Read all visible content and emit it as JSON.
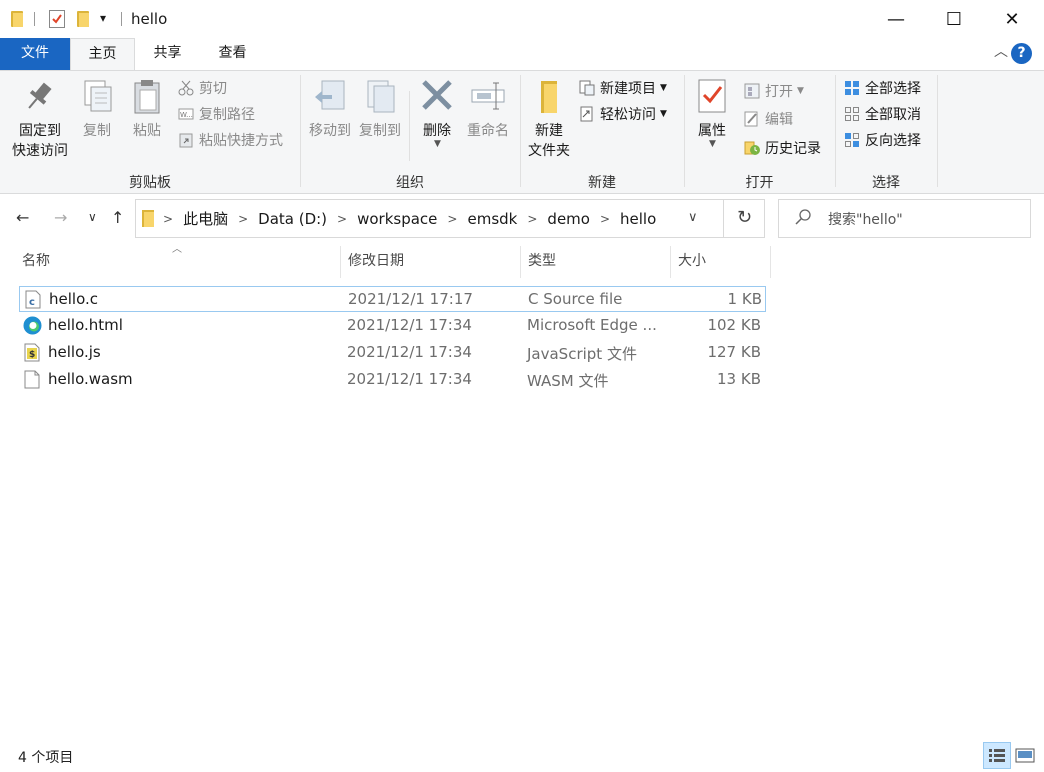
{
  "window": {
    "title": "hello",
    "controls": {
      "minimize": "—",
      "maximize": "☐",
      "close": "✕"
    }
  },
  "quick_access": {
    "dropdown": "▾"
  },
  "tabs": [
    "文件",
    "主页",
    "共享",
    "查看"
  ],
  "help": "?",
  "ribbon": {
    "clipboard": {
      "label": "剪贴板",
      "pin": "固定到\n快速访问",
      "copy": "复制",
      "paste": "粘贴",
      "cut": "剪切",
      "copy_path": "复制路径",
      "paste_shortcut": "粘贴快捷方式"
    },
    "organize": {
      "label": "组织",
      "move_to": "移动到",
      "copy_to": "复制到",
      "delete": "删除",
      "rename": "重命名"
    },
    "new": {
      "label": "新建",
      "new_folder": "新建\n文件夹",
      "new_item": "新建项目",
      "easy_access": "轻松访问"
    },
    "open": {
      "label": "打开",
      "properties": "属性",
      "open": "打开",
      "edit": "编辑",
      "history": "历史记录"
    },
    "select": {
      "label": "选择",
      "select_all": "全部选择",
      "select_none": "全部取消",
      "invert": "反向选择"
    }
  },
  "nav": {
    "back": "←",
    "forward": "→",
    "recent": "∨",
    "up": "↑",
    "refresh": "↻"
  },
  "breadcrumb": [
    "此电脑",
    "Data (D:)",
    "workspace",
    "emsdk",
    "demo",
    "hello"
  ],
  "search": {
    "placeholder": "搜索\"hello\""
  },
  "columns": [
    "名称",
    "修改日期",
    "类型",
    "大小"
  ],
  "files": [
    {
      "name": "hello.c",
      "date": "2021/12/1 17:17",
      "type": "C Source file",
      "size": "1 KB",
      "icon": "c-source-file-icon"
    },
    {
      "name": "hello.html",
      "date": "2021/12/1 17:34",
      "type": "Microsoft Edge ...",
      "size": "102 KB",
      "icon": "edge-html-icon"
    },
    {
      "name": "hello.js",
      "date": "2021/12/1 17:34",
      "type": "JavaScript 文件",
      "size": "127 KB",
      "icon": "javascript-file-icon"
    },
    {
      "name": "hello.wasm",
      "date": "2021/12/1 17:34",
      "type": "WASM 文件",
      "size": "13 KB",
      "icon": "blank-file-icon"
    }
  ],
  "status": {
    "count": "4 个项目"
  },
  "colors": {
    "accent": "#1a66c2",
    "selection_border": "#99c9f0",
    "folder": "#f8d56b"
  }
}
